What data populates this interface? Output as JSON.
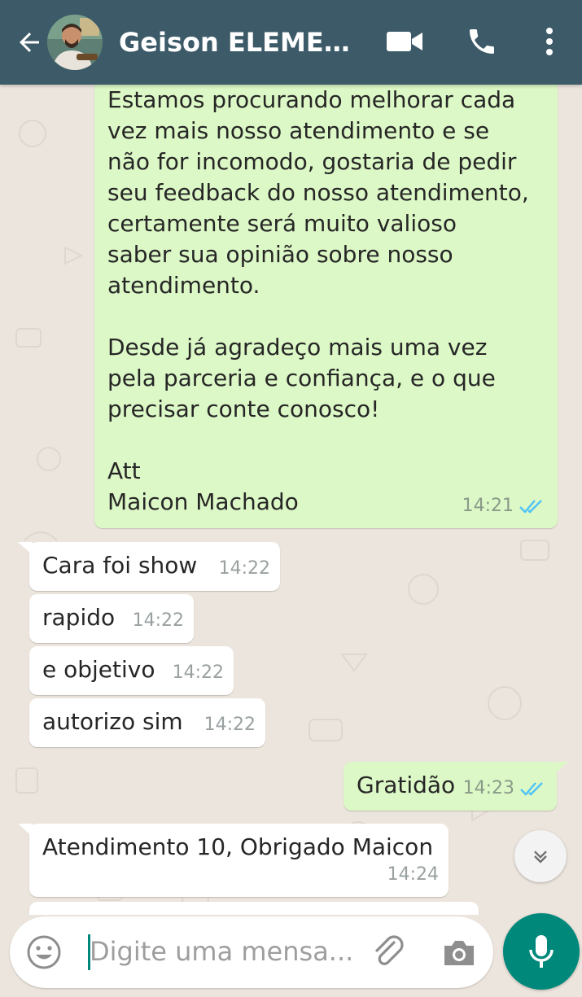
{
  "header": {
    "contact_name": "Geison ELEMENT...",
    "back_icon": "arrow-left-icon",
    "video_icon": "video-call-icon",
    "call_icon": "phone-icon",
    "menu_icon": "more-vert-icon"
  },
  "colors": {
    "header_bg": "#3c5a68",
    "outgoing_bubble": "#dcf8c6",
    "incoming_bubble": "#ffffff",
    "chat_bg": "#ece5dd",
    "read_ticks": "#4fc3f7",
    "accent": "#00897b"
  },
  "messages": [
    {
      "direction": "out",
      "lines": [
        "Estamos procurando melhorar cada",
        "vez mais nosso atendimento e se",
        "não for incomodo, gostaria de pedir",
        "seu feedback do nosso atendimento,",
        "certamente será muito valioso",
        "saber sua opinião sobre nosso",
        "atendimento.",
        "",
        "Desde já agradeço mais uma vez",
        "pela parceria e confiança, e o que",
        "precisar conte conosco!",
        "",
        "Att",
        "Maicon Machado"
      ],
      "time": "14:21",
      "status": "read"
    },
    {
      "direction": "in",
      "text": "Cara foi show",
      "time": "14:22"
    },
    {
      "direction": "in",
      "text": "rapido",
      "time": "14:22"
    },
    {
      "direction": "in",
      "text": "e objetivo",
      "time": "14:22"
    },
    {
      "direction": "in",
      "text": "autorizo sim",
      "time": "14:22"
    },
    {
      "direction": "out",
      "text": "Gratidão",
      "time": "14:23",
      "status": "read"
    },
    {
      "direction": "in",
      "text": "Atendimento 10, Obrigado Maicon",
      "time": "14:24"
    }
  ],
  "composer": {
    "placeholder": "Digite uma mensa...",
    "emoji_icon": "emoji-icon",
    "attach_icon": "paperclip-icon",
    "camera_icon": "camera-icon",
    "mic_icon": "microphone-icon"
  },
  "scroll_button_icon": "chevrons-down-icon"
}
